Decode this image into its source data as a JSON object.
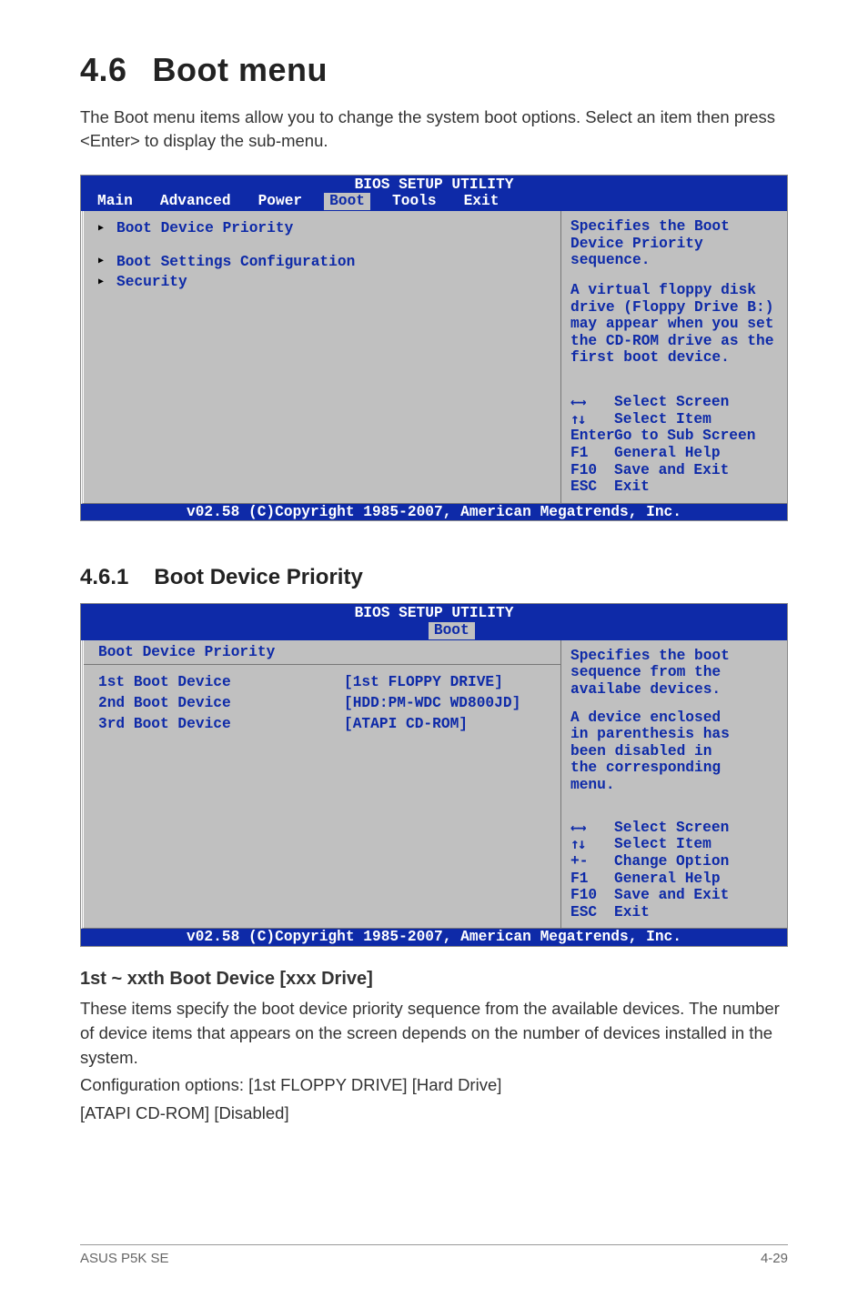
{
  "section": {
    "number": "4.6",
    "title": "Boot menu"
  },
  "intro": "The Boot menu items allow you to change the system boot options. Select an item then press <Enter> to display the sub-menu.",
  "bios1": {
    "header": "BIOS SETUP UTILITY",
    "tabs": [
      "Main",
      "Advanced",
      "Power",
      "Boot",
      "Tools",
      "Exit"
    ],
    "left": {
      "items": [
        "Boot Device Priority",
        "Boot Settings Configuration",
        "Security"
      ]
    },
    "right": {
      "help1_l1": "Specifies the Boot",
      "help1_l2": "Device Priority",
      "help1_l3": "sequence.",
      "help2_l1": "A virtual floppy disk",
      "help2_l2": "drive (Floppy Drive B:)",
      "help2_l3": "may appear when you set",
      "help2_l4": "the CD-ROM drive as the",
      "help2_l5": "first boot device.",
      "nav": {
        "k1": "←→",
        "v1": "Select Screen",
        "k2": "↑↓",
        "v2": "Select Item",
        "k3": "Enter",
        "v3": "Go to Sub Screen",
        "k4": "F1",
        "v4": "General Help",
        "k5": "F10",
        "v5": "Save and Exit",
        "k6": "ESC",
        "v6": "Exit"
      }
    },
    "footer": "v02.58 (C)Copyright 1985-2007, American Megatrends, Inc."
  },
  "subsection": {
    "number": "4.6.1",
    "title": "Boot Device Priority"
  },
  "bios2": {
    "header": "BIOS SETUP UTILITY",
    "tab": "Boot",
    "left": {
      "heading": "Boot Device Priority",
      "rows": [
        {
          "label": "1st Boot Device",
          "value": "[1st FLOPPY DRIVE]"
        },
        {
          "label": "2nd Boot Device",
          "value": "[HDD:PM-WDC WD800JD]"
        },
        {
          "label": "3rd Boot Device",
          "value": "[ATAPI CD-ROM]"
        }
      ]
    },
    "right": {
      "l1": "Specifies the boot",
      "l2": "sequence from the",
      "l3": "availabe devices.",
      "l4": "A device enclosed",
      "l5": "in parenthesis has",
      "l6": "been disabled in",
      "l7": "the corresponding",
      "l8": "menu.",
      "nav": {
        "k1": "←→",
        "v1": "Select Screen",
        "k2": "↑↓",
        "v2": "Select Item",
        "k3": "+-",
        "v3": "Change Option",
        "k4": "F1",
        "v4": "General Help",
        "k5": "F10",
        "v5": "Save and Exit",
        "k6": "ESC",
        "v6": "Exit"
      }
    },
    "footer": "v02.58 (C)Copyright 1985-2007, American Megatrends, Inc."
  },
  "item_title": "1st ~ xxth Boot Device [xxx Drive]",
  "item_p1": "These items specify the boot device priority sequence from the available devices. The number of device items that appears on the screen depends on the number of devices installed in the system.",
  "item_p2": "Configuration options: [1st FLOPPY DRIVE] [Hard Drive]",
  "item_p3": "[ATAPI CD-ROM] [Disabled]",
  "footer": {
    "left": "ASUS P5K SE",
    "right": "4-29"
  }
}
